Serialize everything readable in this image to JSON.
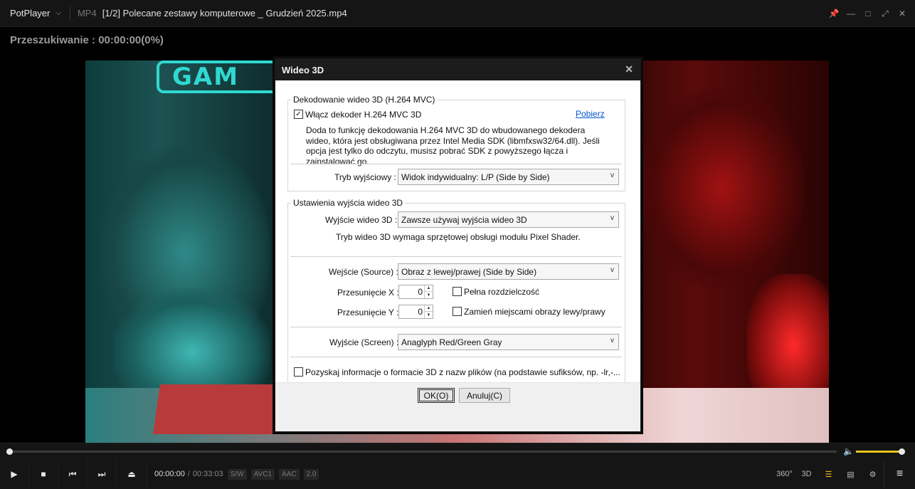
{
  "app": {
    "brand": "PotPlayer",
    "format": "MP4",
    "title": "[1/2] Polecane zestawy komputerowe _ Grudzień 2025.mp4"
  },
  "osd": {
    "text": "Przeszukiwanie : 00:00:00(0%)"
  },
  "video_sign": "GAM",
  "player": {
    "time_current": "00:00:00",
    "time_separator": "/",
    "time_total": "00:33:03",
    "tags": [
      "S/W",
      "AVC1",
      "AAC",
      "2.0"
    ],
    "right_buttons": {
      "vr": "360°",
      "three_d": "3D"
    },
    "seek_fraction": 0.0,
    "volume_fraction": 1.0,
    "accent_color": "#e8c21a"
  },
  "dialog": {
    "title": "Wideo 3D",
    "group_decode": {
      "legend": "Dekodowanie wideo 3D (H.264 MVC)",
      "enable_label": "Włącz dekoder H.264 MVC 3D",
      "enable_checked": true,
      "download_link": "Pobierz",
      "description": "Doda to funkcję dekodowania H.264 MVC 3D do wbudowanego dekodera wideo, która jest obsługiwana przez Intel Media SDK (libmfxsw32/64.dll). Jeśli opcja jest tylko do odczytu, musisz pobrać SDK z powyższego łącza i zainstalować go.",
      "output_mode_label": "Tryb wyjściowy :",
      "output_mode_value": "Widok indywidualny: L/P (Side by Side)"
    },
    "group_output": {
      "legend": "Ustawienia wyjścia wideo 3D",
      "video_output_label": "Wyjście wideo 3D :",
      "video_output_value": "Zawsze używaj wyjścia wideo 3D",
      "shader_note": "Tryb wideo 3D wymaga sprzętowej obsługi modułu Pixel Shader.",
      "source_label": "Wejście (Source) :",
      "source_value": "Obraz z lewej/prawej (Side by Side)",
      "offset_x_label": "Przesunięcie X :",
      "offset_x_value": "0",
      "offset_y_label": "Przesunięcie Y :",
      "offset_y_value": "0",
      "full_res_label": "Pełna rozdzielczość",
      "full_res_checked": false,
      "swap_label": "Zamień miejscami obrazy lewy/prawy",
      "swap_checked": false,
      "screen_label": "Wyjście (Screen) :",
      "screen_value": "Anaglyph Red/Green Gray",
      "suffix_label": "Pozyskaj informacje o formacie 3D z nazw plików (na podstawie sufiksów, np. -lr,-...",
      "suffix_checked": false
    },
    "ok_label": "OK(O)",
    "cancel_label": "Anuluj(C)"
  }
}
